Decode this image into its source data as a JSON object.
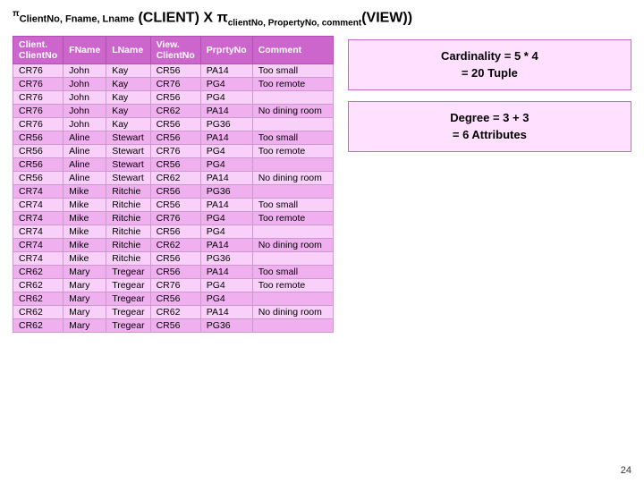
{
  "header": {
    "pi_left": "π",
    "subscript_left": "ClientNo, Fname, Lname",
    "main_text": "(CLIENT) X π",
    "subscript_right": "clientNo, PropertyNo, comment",
    "suffix": "(VIEW))"
  },
  "table": {
    "headers": [
      "Client.ClientNo",
      "FName",
      "LName",
      "View.ClientNo",
      "PrprtyNo",
      "Comment"
    ],
    "rows": [
      [
        "CR76",
        "John",
        "Kay",
        "CR56",
        "PA14",
        "Too small"
      ],
      [
        "CR76",
        "John",
        "Kay",
        "CR76",
        "PG4",
        "Too remote"
      ],
      [
        "CR76",
        "John",
        "Kay",
        "CR56",
        "PG4",
        ""
      ],
      [
        "CR76",
        "John",
        "Kay",
        "CR62",
        "PA14",
        "No dining room"
      ],
      [
        "CR76",
        "John",
        "Kay",
        "CR56",
        "PG36",
        ""
      ],
      [
        "CR56",
        "Aline",
        "Stewart",
        "CR56",
        "PA14",
        "Too small"
      ],
      [
        "CR56",
        "Aline",
        "Stewart",
        "CR76",
        "PG4",
        "Too remote"
      ],
      [
        "CR56",
        "Aline",
        "Stewart",
        "CR56",
        "PG4",
        ""
      ],
      [
        "CR56",
        "Aline",
        "Stewart",
        "CR62",
        "PA14",
        "No dining room"
      ],
      [
        "CR74",
        "Mike",
        "Ritchie",
        "CR56",
        "PG36",
        ""
      ],
      [
        "CR74",
        "Mike",
        "Ritchie",
        "CR56",
        "PA14",
        "Too small"
      ],
      [
        "CR74",
        "Mike",
        "Ritchie",
        "CR76",
        "PG4",
        "Too remote"
      ],
      [
        "CR74",
        "Mike",
        "Ritchie",
        "CR56",
        "PG4",
        ""
      ],
      [
        "CR74",
        "Mike",
        "Ritchie",
        "CR62",
        "PA14",
        "No dining room"
      ],
      [
        "CR74",
        "Mike",
        "Ritchie",
        "CR56",
        "PG36",
        ""
      ],
      [
        "CR62",
        "Mary",
        "Tregear",
        "CR56",
        "PA14",
        "Too small"
      ],
      [
        "CR62",
        "Mary",
        "Tregear",
        "CR76",
        "PG4",
        "Too remote"
      ],
      [
        "CR62",
        "Mary",
        "Tregear",
        "CR56",
        "PG4",
        ""
      ],
      [
        "CR62",
        "Mary",
        "Tregear",
        "CR62",
        "PA14",
        "No dining room"
      ],
      [
        "CR62",
        "Mary",
        "Tregear",
        "CR56",
        "PG36",
        ""
      ]
    ]
  },
  "right_panel": {
    "cardinality_line1": "Cardinality = 5 * 4",
    "cardinality_line2": "= 20 Tuple",
    "degree_line1": "Degree = 3 + 3",
    "degree_line2": "= 6 Attributes"
  },
  "page_number": "24"
}
